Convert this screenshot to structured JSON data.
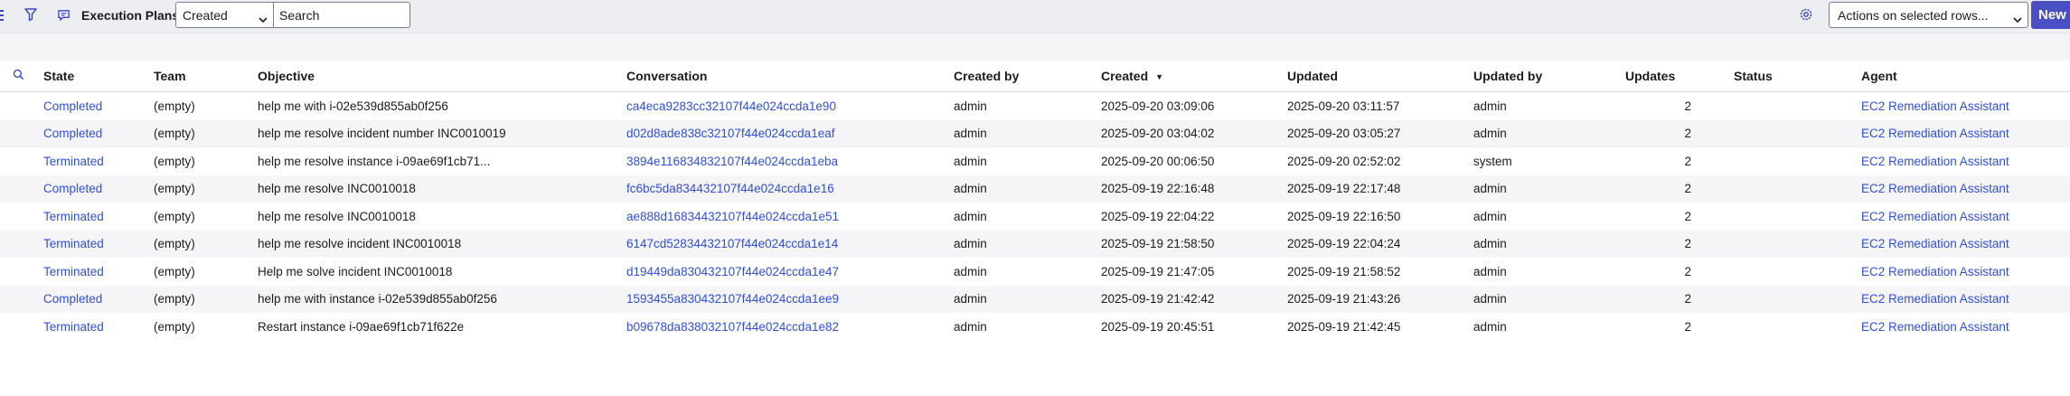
{
  "toolbar": {
    "title": "Execution Plans",
    "filter_field_value": "Created",
    "search_placeholder": "Search",
    "actions_value": "Actions on selected rows...",
    "new_label": "New"
  },
  "colors": {
    "accent": "#4a4fc4",
    "link": "#2f4fd9",
    "toolbar_bg": "#eceef2"
  },
  "table": {
    "columns": [
      "State",
      "Team",
      "Objective",
      "Conversation",
      "Created by",
      "Created",
      "Updated",
      "Updated by",
      "Updates",
      "Status",
      "Agent"
    ],
    "sort_indicator": "▼",
    "rows": [
      {
        "state": "Completed",
        "team": "(empty)",
        "objective": "help me with i-02e539d855ab0f256",
        "conversation": "ca4eca9283cc32107f44e024ccda1e90",
        "created_by": "admin",
        "created": "2025-09-20 03:09:06",
        "updated": "2025-09-20 03:11:57",
        "updated_by": "admin",
        "updates": "2",
        "status": "",
        "agent": "EC2 Remediation Assistant"
      },
      {
        "state": "Completed",
        "team": "(empty)",
        "objective": "help me resolve incident number INC0010019",
        "conversation": "d02d8ade838c32107f44e024ccda1eaf",
        "created_by": "admin",
        "created": "2025-09-20 03:04:02",
        "updated": "2025-09-20 03:05:27",
        "updated_by": "admin",
        "updates": "2",
        "status": "",
        "agent": "EC2 Remediation Assistant"
      },
      {
        "state": "Terminated",
        "team": "(empty)",
        "objective": "help me resolve instance i-09ae69f1cb71...",
        "conversation": "3894e116834832107f44e024ccda1eba",
        "created_by": "admin",
        "created": "2025-09-20 00:06:50",
        "updated": "2025-09-20 02:52:02",
        "updated_by": "system",
        "updates": "2",
        "status": "",
        "agent": "EC2 Remediation Assistant"
      },
      {
        "state": "Completed",
        "team": "(empty)",
        "objective": "help me resolve INC0010018",
        "conversation": "fc6bc5da834432107f44e024ccda1e16",
        "created_by": "admin",
        "created": "2025-09-19 22:16:48",
        "updated": "2025-09-19 22:17:48",
        "updated_by": "admin",
        "updates": "2",
        "status": "",
        "agent": "EC2 Remediation Assistant"
      },
      {
        "state": "Terminated",
        "team": "(empty)",
        "objective": "help me resolve INC0010018",
        "conversation": "ae888d16834432107f44e024ccda1e51",
        "created_by": "admin",
        "created": "2025-09-19 22:04:22",
        "updated": "2025-09-19 22:16:50",
        "updated_by": "admin",
        "updates": "2",
        "status": "",
        "agent": "EC2 Remediation Assistant"
      },
      {
        "state": "Terminated",
        "team": "(empty)",
        "objective": "help me resolve incident INC0010018",
        "conversation": "6147cd52834432107f44e024ccda1e14",
        "created_by": "admin",
        "created": "2025-09-19 21:58:50",
        "updated": "2025-09-19 22:04:24",
        "updated_by": "admin",
        "updates": "2",
        "status": "",
        "agent": "EC2 Remediation Assistant"
      },
      {
        "state": "Terminated",
        "team": "(empty)",
        "objective": "Help me solve incident INC0010018",
        "conversation": "d19449da830432107f44e024ccda1e47",
        "created_by": "admin",
        "created": "2025-09-19 21:47:05",
        "updated": "2025-09-19 21:58:52",
        "updated_by": "admin",
        "updates": "2",
        "status": "",
        "agent": "EC2 Remediation Assistant"
      },
      {
        "state": "Completed",
        "team": "(empty)",
        "objective": "help me with instance i-02e539d855ab0f256",
        "conversation": "1593455a830432107f44e024ccda1ee9",
        "created_by": "admin",
        "created": "2025-09-19 21:42:42",
        "updated": "2025-09-19 21:43:26",
        "updated_by": "admin",
        "updates": "2",
        "status": "",
        "agent": "EC2 Remediation Assistant"
      },
      {
        "state": "Terminated",
        "team": "(empty)",
        "objective": "Restart instance i-09ae69f1cb71f622e",
        "conversation": "b09678da838032107f44e024ccda1e82",
        "created_by": "admin",
        "created": "2025-09-19 20:45:51",
        "updated": "2025-09-19 21:42:45",
        "updated_by": "admin",
        "updates": "2",
        "status": "",
        "agent": "EC2 Remediation Assistant"
      }
    ]
  }
}
